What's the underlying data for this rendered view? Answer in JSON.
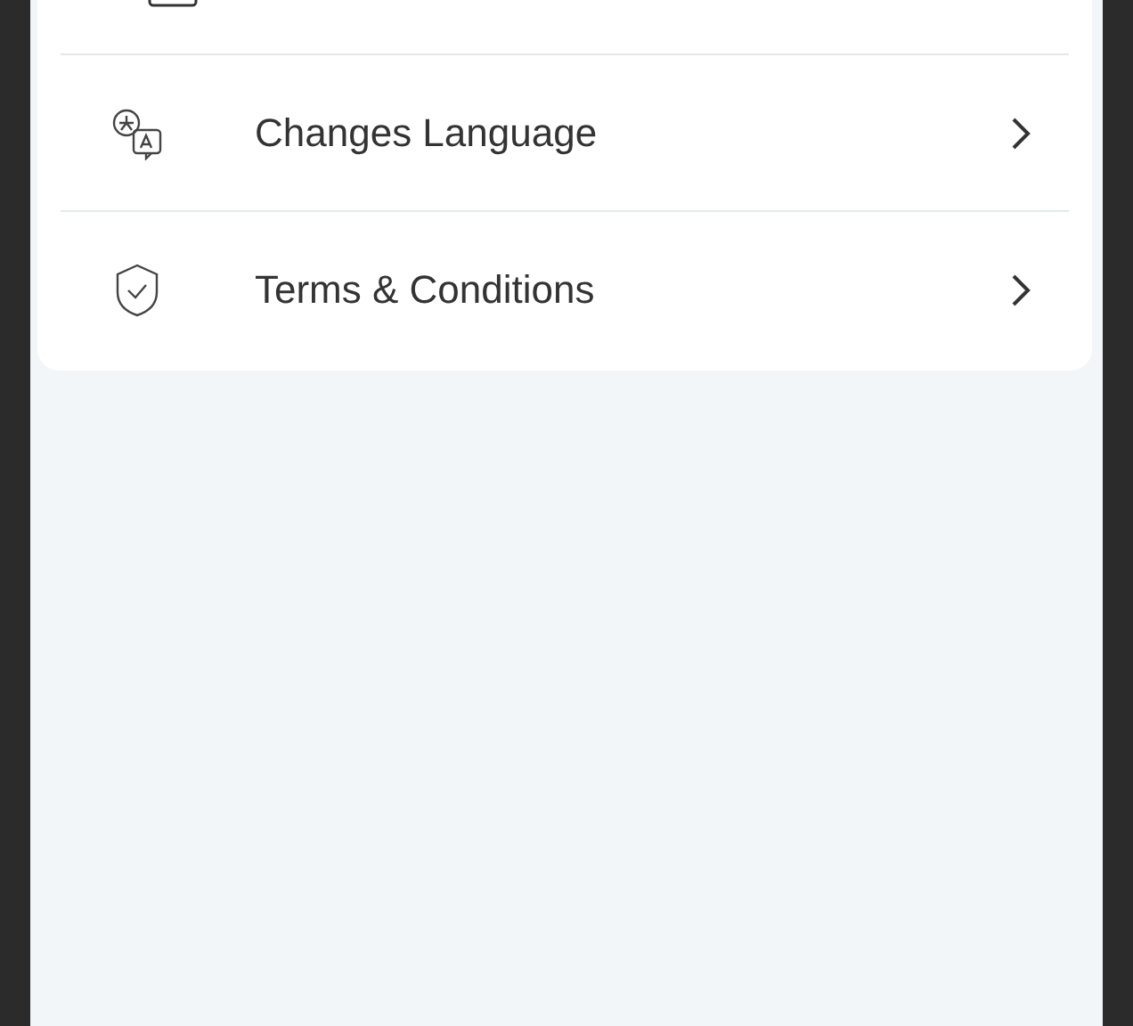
{
  "settings_items": [
    {
      "kind": "language",
      "label": "Changes Language"
    },
    {
      "kind": "terms",
      "label": "Terms & Conditions"
    }
  ]
}
